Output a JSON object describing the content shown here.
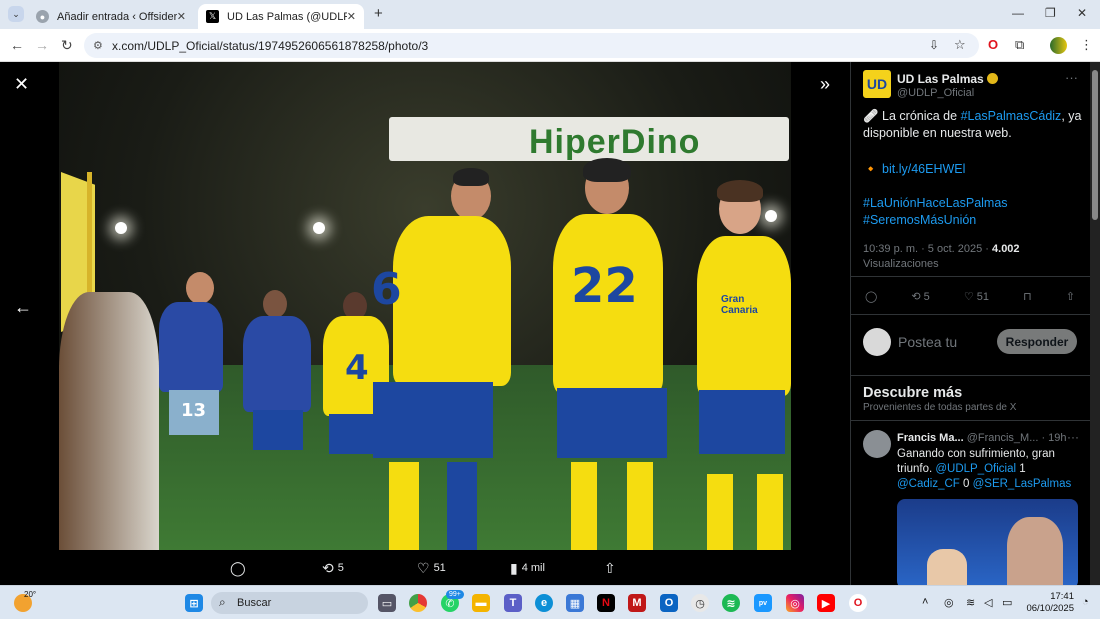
{
  "browser": {
    "tabs": [
      {
        "label": "Añadir entrada ‹ Offsider — W",
        "active": false
      },
      {
        "label": "UD Las Palmas (@UDLP_Oficial)",
        "active": true
      }
    ],
    "new_tab": "+",
    "url": "x.com/UDLP_Oficial/status/1974952606561878258/photo/3",
    "window_controls": {
      "minimize": "—",
      "restore": "❐",
      "close": "✕"
    }
  },
  "photo": {
    "billboard_text": "HiperDino",
    "jersey_numbers": [
      "6",
      "22",
      "4",
      "13"
    ],
    "jersey_sponsor": "Gran Canaria",
    "overlay_actions": {
      "reply": "",
      "retweets": "5",
      "likes": "51",
      "views": "4 mil"
    }
  },
  "tweet": {
    "author_name": "UD Las Palmas",
    "author_handle": "@UDLP_Oficial",
    "avatar_initials": "UD",
    "text_line1_prefix": "🩹 La crónica de ",
    "text_hashtag1": "#LasPalmasCádiz",
    "text_line1_suffix": ", ya disponible en nuestra web.",
    "link_prefix": "🔸 ",
    "link": "bit.ly/46EHWEl",
    "hashtag2": "#LaUniónHaceLasPalmas",
    "hashtag3": "#SeremosMásUnión",
    "timestamp": "10:39 p. m. · 5 oct. 2025 · ",
    "views_count": "4.002",
    "views_label": "Visualizaciones",
    "retweets": "5",
    "likes": "51",
    "reply_placeholder": "Postea tu",
    "reply_button": "Responder"
  },
  "discover": {
    "title": "Descubre más",
    "subtitle": "Provenientes de todas partes de X",
    "post": {
      "author_name": "Francis Ma...",
      "author_handle": "@Francis_M...",
      "time": "· 19h",
      "text_main": "Ganando con sufrimiento, gran triunfo. ",
      "mention1": "@UDLP_Oficial",
      "score1": " 1 ",
      "mention2": "@Cadiz_CF",
      "score2": " 0",
      "mention3": "@SER_LasPalmas"
    }
  },
  "taskbar": {
    "weather_temp": "20°",
    "search_label": "Buscar",
    "notification_badge": "99+",
    "time": "17:41",
    "date": "06/10/2025"
  },
  "colors": {
    "x_blue": "#1d9bf0",
    "las_palmas_yellow": "#f5dd10",
    "las_palmas_blue": "#1d47a0"
  }
}
